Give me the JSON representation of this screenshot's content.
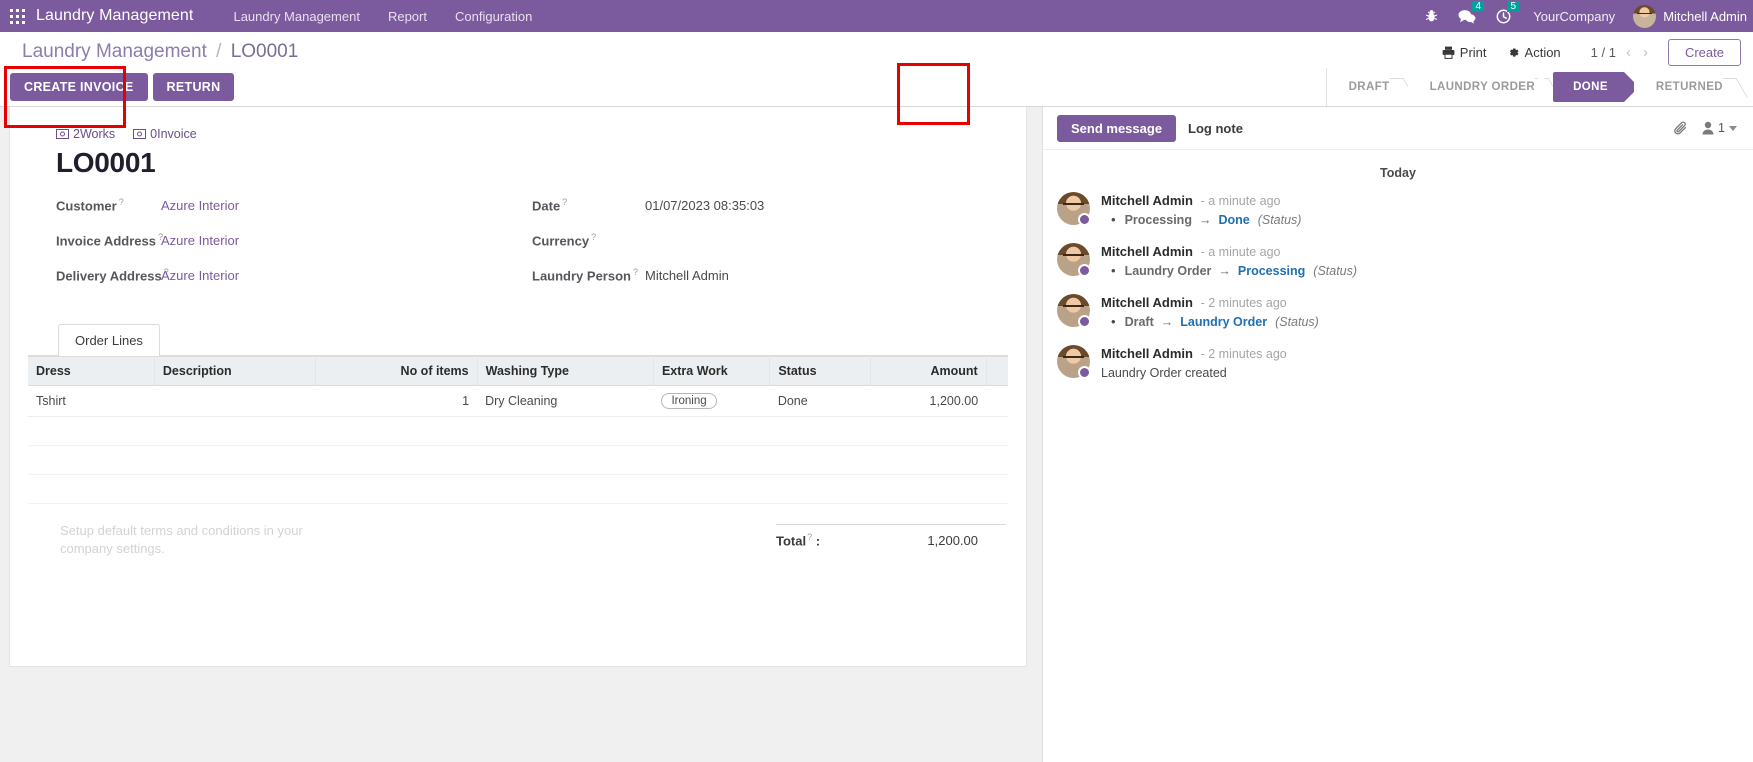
{
  "navbar": {
    "apps_icon": "apps-grid-icon",
    "brand": "Laundry Management",
    "menus": [
      {
        "label": "Laundry Management"
      },
      {
        "label": "Report"
      },
      {
        "label": "Configuration"
      }
    ],
    "bug_icon": "bug-icon",
    "messages": {
      "icon": "chat-bubble-icon",
      "count": "4"
    },
    "activities": {
      "icon": "clock-icon",
      "count": "5"
    },
    "company": "YourCompany",
    "user": "Mitchell Admin"
  },
  "control_panel": {
    "breadcrumb_root": "Laundry Management",
    "breadcrumb_sep": "/",
    "breadcrumb_current": "LO0001",
    "print_label": "Print",
    "print_icon": "printer-icon",
    "action_label": "Action",
    "action_icon": "gear-icon",
    "pager": "1 / 1",
    "pager_prev": "‹",
    "pager_next": "›",
    "create_label": "Create",
    "buttons": [
      {
        "label": "CREATE INVOICE",
        "name": "create-invoice-button"
      },
      {
        "label": "RETURN",
        "name": "return-button"
      }
    ],
    "statusbar": [
      {
        "label": "DRAFT",
        "active": false
      },
      {
        "label": "LAUNDRY ORDER",
        "active": false
      },
      {
        "label": "DONE",
        "active": true
      },
      {
        "label": "RETURNED",
        "active": false
      }
    ]
  },
  "form": {
    "smart_buttons": [
      {
        "icon": "money-bill-icon",
        "count": "2",
        "label": "Works"
      },
      {
        "icon": "money-bill-icon",
        "count": "0",
        "label": "Invoice"
      }
    ],
    "title": "LO0001",
    "left_fields": [
      {
        "label": "Customer",
        "value": "Azure Interior",
        "is_link": true
      },
      {
        "label": "Invoice Address",
        "value": "Azure Interior",
        "is_link": true
      },
      {
        "label": "Delivery Address",
        "value": "Azure Interior",
        "is_link": true
      }
    ],
    "right_fields": [
      {
        "label": "Date",
        "value": "01/07/2023 08:35:03",
        "is_link": false
      },
      {
        "label": "Currency",
        "value": "",
        "is_link": false
      },
      {
        "label": "Laundry Person",
        "value": "Mitchell Admin",
        "is_link": false
      }
    ],
    "help_marker": "?",
    "tabs": [
      {
        "label": "Order Lines",
        "active": true
      }
    ],
    "table": {
      "columns": [
        {
          "label": "Dress",
          "align": "left"
        },
        {
          "label": "Description",
          "align": "left"
        },
        {
          "label": "No of items",
          "align": "right"
        },
        {
          "label": "Washing Type",
          "align": "left"
        },
        {
          "label": "Extra Work",
          "align": "left"
        },
        {
          "label": "Status",
          "align": "left"
        },
        {
          "label": "Amount",
          "align": "right"
        }
      ],
      "rows": [
        {
          "dress": "Tshirt",
          "description": "",
          "no_of_items": "1",
          "washing_type": "Dry Cleaning",
          "extra_work": "Ironing",
          "status": "Done",
          "amount": "1,200.00"
        }
      ],
      "empty_rows": 3
    },
    "terms_placeholder": "Setup default terms and conditions in your company settings.",
    "total_label": "Total",
    "total_value": "1,200.00"
  },
  "chatter": {
    "send_message_label": "Send message",
    "log_note_label": "Log note",
    "attachment_icon": "paperclip-icon",
    "followers_icon": "user-icon",
    "followers_count": "1",
    "day_separator": "Today",
    "messages": [
      {
        "author": "Mitchell Admin",
        "time": "- a minute ago",
        "type": "tracking",
        "old_value": "Processing",
        "arrow": "→",
        "new_value": "Done",
        "field": "(Status)"
      },
      {
        "author": "Mitchell Admin",
        "time": "- a minute ago",
        "type": "tracking",
        "old_value": "Laundry Order",
        "arrow": "→",
        "new_value": "Processing",
        "field": "(Status)"
      },
      {
        "author": "Mitchell Admin",
        "time": "- 2 minutes ago",
        "type": "tracking",
        "old_value": "Draft",
        "arrow": "→",
        "new_value": "Laundry Order",
        "field": "(Status)"
      },
      {
        "author": "Mitchell Admin",
        "time": "- 2 minutes ago",
        "type": "plain",
        "text": "Laundry Order created"
      }
    ]
  },
  "colors": {
    "brand_purple": "#7c5a9e",
    "badge_teal": "#00a09d",
    "annotation_red": "#e60000",
    "link_blue": "#1f6fb2"
  }
}
